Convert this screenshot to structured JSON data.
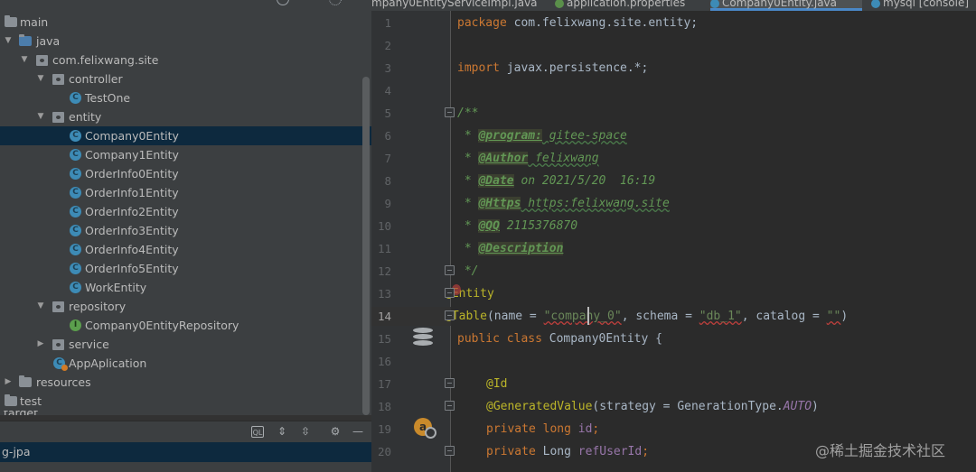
{
  "tabs": [
    {
      "label": "mpany0EntityServiceImpl.java",
      "icon": "java-class-icon"
    },
    {
      "label": "application.properties",
      "icon": "properties-icon"
    },
    {
      "label": "Company0Entity.java",
      "icon": "java-class-icon",
      "active": true
    },
    {
      "label": "mysql [console]",
      "icon": "console-icon"
    }
  ],
  "tree": {
    "main": "main",
    "java": "java",
    "package": "com.felixwang.site",
    "controller": "controller",
    "test_one": "TestOne",
    "entity": "entity",
    "company0": "Company0Entity",
    "company1": "Company1Entity",
    "order0": "OrderInfo0Entity",
    "order1": "OrderInfo1Entity",
    "order2": "OrderInfo2Entity",
    "order3": "OrderInfo3Entity",
    "order4": "OrderInfo4Entity",
    "order5": "OrderInfo5Entity",
    "work": "WorkEntity",
    "repository": "repository",
    "repo_item": "Company0EntityRepository",
    "service": "service",
    "app": "AppAplication",
    "resources": "resources",
    "test": "test",
    "target": "target"
  },
  "bottom_panel": {
    "item": "g-jpa"
  },
  "line_numbers": [
    "1",
    "2",
    "3",
    "4",
    "5",
    "6",
    "7",
    "8",
    "9",
    "10",
    "11",
    "12",
    "13",
    "14",
    "15",
    "16",
    "17",
    "18",
    "19",
    "20"
  ],
  "current_line": "14",
  "code": {
    "l1_kw": "package",
    "l1_rest": " com.felixwang.site.entity;",
    "l3_kw": "import",
    "l3_rest": " javax.persistence.*;",
    "l5": "/**",
    "l6_star": " * ",
    "l6_tag": "@program:",
    "l6_val": " gitee-space",
    "l7_tag": "@Author",
    "l7_val": " felixwang",
    "l8_tag": "@Date",
    "l8_val": " on 2021/5/20  16:19",
    "l9_tag": "@Https",
    "l9_val": " https:felixwang.site",
    "l10_tag": "@QQ",
    "l10_val": " 2115376870",
    "l11_tag": "@Description",
    "l12": " */",
    "l13_at": "@",
    "l13_e": "E",
    "l13_rest": "ntity",
    "l14_ann": "@Table",
    "l14_p1": "(name = ",
    "l14_s1": "\"company_0\"",
    "l14_p2": ", schema = ",
    "l14_s2": "\"db_1\"",
    "l14_p3": ", catalog = ",
    "l14_s3": "\"\"",
    "l14_p4": ")",
    "l15_kw": "public class",
    "l15_rest": " Company0Entity {",
    "l17_ann": "@Id",
    "l18_ann": "@GeneratedValue",
    "l18_p1": "(strategy = GenerationType.",
    "l18_const": "AUTO",
    "l18_p2": ")",
    "l19_kw": "private long",
    "l19_field": " id",
    "l19_end": ";",
    "l20_kw": "private",
    "l20_type": " Long ",
    "l20_field": "refUserId",
    "l20_end": ";"
  },
  "watermark": "@稀土掘金技术社区",
  "colors": {
    "keyword": "#cc7832",
    "string": "#6a8759",
    "annotation": "#bbb529",
    "doc_comment": "#629755",
    "selection": "#0d293e",
    "active_tab_underline": "#4a88c7"
  }
}
